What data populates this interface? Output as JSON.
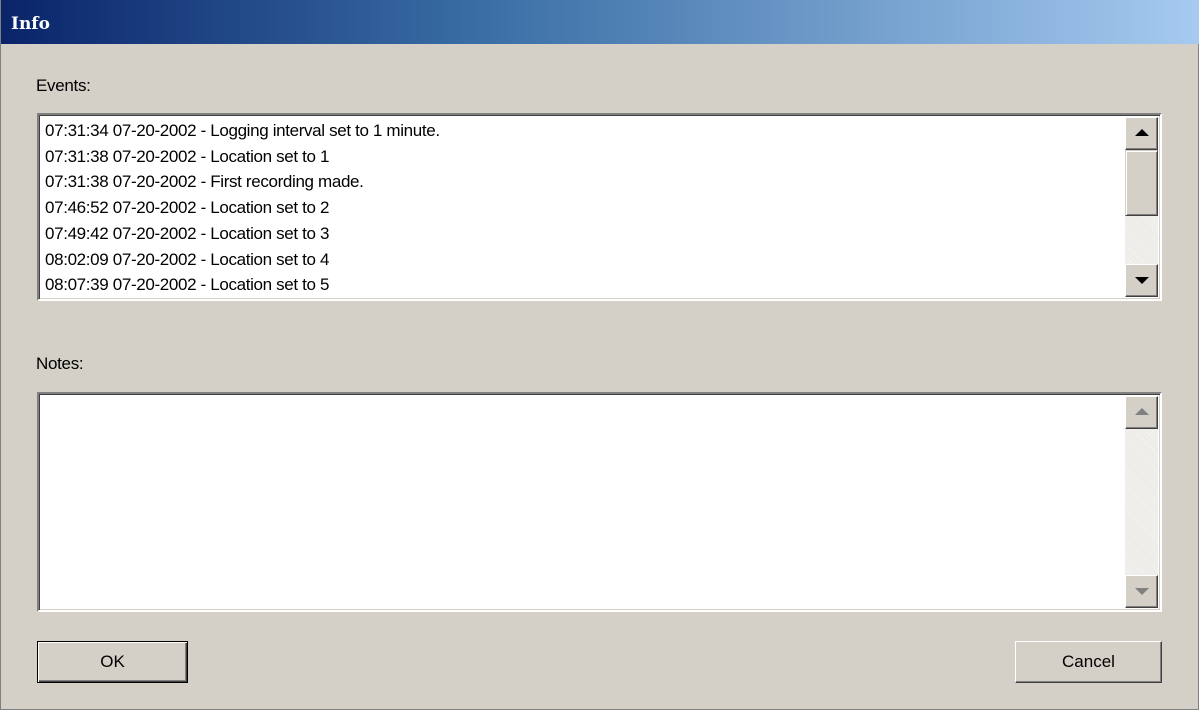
{
  "window": {
    "title": "Info"
  },
  "events": {
    "label": "Events:",
    "items": [
      "07:31:34 07-20-2002 - Logging interval set to 1 minute.",
      "07:31:38 07-20-2002 - Location set to 1",
      "07:31:38 07-20-2002 - First recording made.",
      "07:46:52 07-20-2002 - Location set to 2",
      "07:49:42 07-20-2002 - Location set to 3",
      "08:02:09 07-20-2002 - Location set to 4",
      "08:07:39 07-20-2002 - Location set to 5"
    ]
  },
  "notes": {
    "label": "Notes:",
    "value": ""
  },
  "buttons": {
    "ok": "OK",
    "cancel": "Cancel"
  },
  "icons": {
    "scroll_up": "up-arrow-icon",
    "scroll_down": "down-arrow-icon"
  },
  "colors": {
    "title_gradient_start": "#0a246a",
    "title_gradient_end": "#a6caf0",
    "face": "#d4d0c8"
  }
}
